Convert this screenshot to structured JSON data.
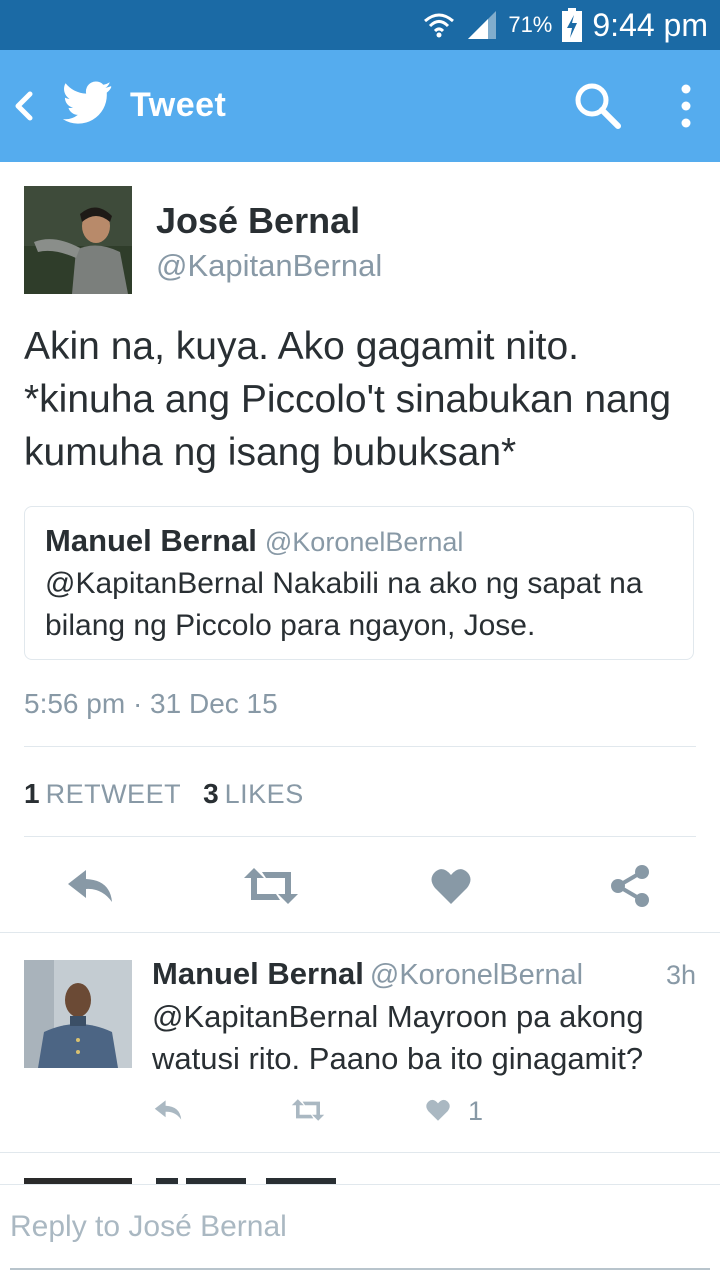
{
  "status_bar": {
    "battery_percent": "71%",
    "time": "9:44 pm"
  },
  "app_bar": {
    "title": "Tweet",
    "icons": [
      "back-icon",
      "twitter-bird-icon",
      "search-icon",
      "more-vert-icon"
    ]
  },
  "tweet": {
    "author_name": "José Bernal",
    "author_handle": "@KapitanBernal",
    "text": "Akin na, kuya. Ako gagamit nito. *kinuha ang Piccolo't sinabukan nang kumuha ng isang bubuksan*",
    "quoted": {
      "name": "Manuel Bernal",
      "handle": "@KoronelBernal",
      "text": "@KapitanBernal Nakabili na ako ng sapat na bilang ng Piccolo para ngayon, Jose."
    },
    "timestamp": "5:56 pm · 31 Dec 15",
    "retweet_count": "1",
    "retweet_label": "RETWEET",
    "like_count": "3",
    "like_label": "LIKES",
    "actions": [
      "reply-icon",
      "retweet-icon",
      "like-icon",
      "share-icon"
    ]
  },
  "reply": {
    "name": "Manuel Bernal",
    "handle": "@KoronelBernal",
    "age": "3h",
    "text": "@KapitanBernal Mayroon pa akong watusi rito. Paano ba ito ginagamit?",
    "like_count": "1"
  },
  "compose": {
    "placeholder": "Reply to José Bernal"
  },
  "colors": {
    "status_bar": "#1b6aa5",
    "app_bar": "#55acee",
    "text": "#292f33",
    "secondary": "#8899a6",
    "divider": "#e1e8ed"
  }
}
